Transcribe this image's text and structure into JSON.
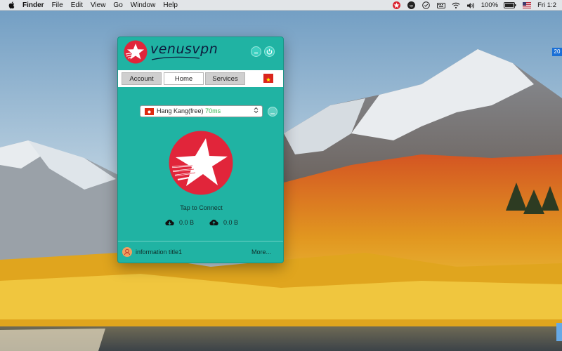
{
  "menubar": {
    "app_name": "Finder",
    "menus": [
      "File",
      "Edit",
      "View",
      "Go",
      "Window",
      "Help"
    ],
    "battery": "100%",
    "clock": "Fri 1:2"
  },
  "desktop": {
    "side_badge": "20"
  },
  "vpn_window": {
    "brand": "venusvpn",
    "tabs": {
      "account": "Account",
      "home": "Home",
      "services": "Services"
    },
    "server": {
      "name": "Hang Kang(free)",
      "ping": "70ms"
    },
    "connect_label": "Tap to Connect",
    "download": "0.0 B",
    "upload": "0.0 B",
    "info_title": "information title1",
    "more_label": "More...",
    "colors": {
      "background": "#20b3a3",
      "accent_red": "#e1253a"
    }
  }
}
